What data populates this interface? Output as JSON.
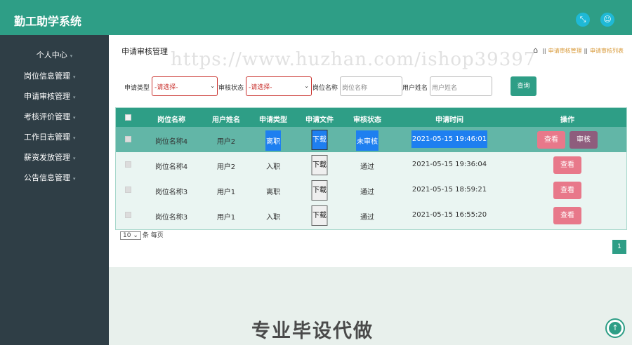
{
  "app": {
    "title": "勤工助学系统"
  },
  "header_icons": [
    "expand-icon",
    "user-icon"
  ],
  "sidebar": {
    "items": [
      {
        "label": "个人中心"
      },
      {
        "label": "岗位信息管理"
      },
      {
        "label": "申请审核管理"
      },
      {
        "label": "考核评价管理"
      },
      {
        "label": "工作日志管理"
      },
      {
        "label": "薪资发放管理"
      },
      {
        "label": "公告信息管理"
      }
    ]
  },
  "page": {
    "title": "申请审核管理",
    "breadcrumb": [
      "申请审核管理",
      "申请审核列表"
    ],
    "watermark": "https://www.huzhan.com/ishop39397"
  },
  "filters": {
    "apply_type_label": "申请类型",
    "apply_type_value": "-请选择-",
    "audit_status_label": "审核状态",
    "audit_status_value": "-请选择-",
    "job_name_label": "岗位名称",
    "job_name_placeholder": "岗位名称",
    "user_name_label": "用户姓名",
    "user_name_placeholder": "用户姓名",
    "query_label": "查询"
  },
  "table": {
    "headers": [
      "岗位名称",
      "用户姓名",
      "申请类型",
      "申请文件",
      "审核状态",
      "申请时间",
      "操作"
    ],
    "rows": [
      {
        "job": "岗位名称4",
        "user": "用户2",
        "type": "离职",
        "file": "下载",
        "status": "未审核",
        "time": "2021-05-15 19:46:01",
        "view": "查看",
        "audit": "审核"
      },
      {
        "job": "岗位名称4",
        "user": "用户2",
        "type": "入职",
        "file": "下载",
        "status": "通过",
        "time": "2021-05-15 19:36:04",
        "view": "查看"
      },
      {
        "job": "岗位名称3",
        "user": "用户1",
        "type": "离职",
        "file": "下载",
        "status": "通过",
        "time": "2021-05-15 18:59:21",
        "view": "查看"
      },
      {
        "job": "岗位名称3",
        "user": "用户1",
        "type": "入职",
        "file": "下载",
        "status": "通过",
        "time": "2021-05-15 16:55:20",
        "view": "查看"
      }
    ]
  },
  "pagination": {
    "page_size": "10",
    "page_size_suffix": "条 每页",
    "current_page": "1"
  },
  "footer": {
    "slogan": "专业毕设代做"
  },
  "colors": {
    "primary": "#2e9e86",
    "sidebar": "#2f3e46",
    "highlight": "#1e7ff0",
    "view_button": "#e8788a",
    "audit_button": "#8e5d7d"
  }
}
